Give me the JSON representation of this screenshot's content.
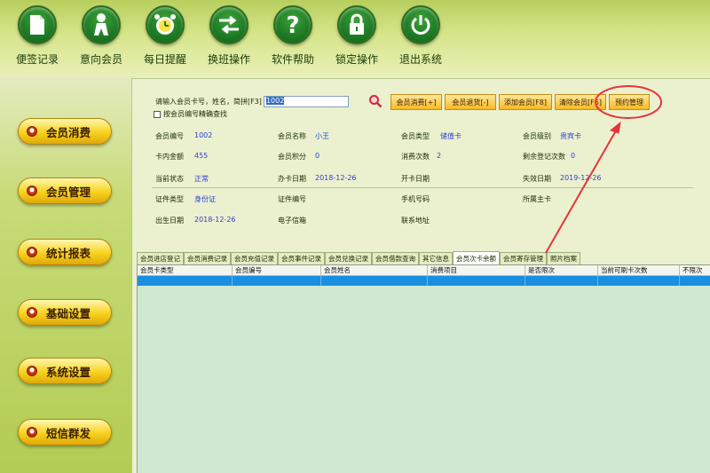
{
  "toolbar": {
    "items": [
      {
        "label": "便签记录",
        "icon": "note-icon"
      },
      {
        "label": "意向会员",
        "icon": "member-icon"
      },
      {
        "label": "每日提醒",
        "icon": "alarm-clock-icon"
      },
      {
        "label": "换班操作",
        "icon": "shift-swap-icon"
      },
      {
        "label": "软件帮助",
        "icon": "help-icon"
      },
      {
        "label": "锁定操作",
        "icon": "lock-icon"
      },
      {
        "label": "退出系统",
        "icon": "power-icon"
      }
    ]
  },
  "sidebar": {
    "items": [
      {
        "label": "会员消费"
      },
      {
        "label": "会员管理"
      },
      {
        "label": "统计报表"
      },
      {
        "label": "基础设置"
      },
      {
        "label": "系统设置"
      },
      {
        "label": "短信群发"
      }
    ]
  },
  "search": {
    "label": "请输入会员卡号，姓名，简拼[F3]",
    "value": "1002",
    "exact_label": "按会员编号精确查找"
  },
  "actions": [
    {
      "label": "会员消费[+]"
    },
    {
      "label": "会员退货[-]"
    },
    {
      "label": "添加会员[F8]"
    },
    {
      "label": "清除会员[F6]"
    },
    {
      "label": "预约管理"
    }
  ],
  "info": {
    "row1": [
      {
        "label": "会员编号",
        "value": "1002"
      },
      {
        "label": "会员名称",
        "value": "小王"
      },
      {
        "label": "会员类型",
        "value": "储值卡"
      },
      {
        "label": "会员级别",
        "value": "贵宾卡"
      }
    ],
    "row2": [
      {
        "label": "卡内金额",
        "value": "455"
      },
      {
        "label": "会员积分",
        "value": "0"
      },
      {
        "label": "消费次数",
        "value": "2"
      },
      {
        "label": "剩余登记次数",
        "value": "0"
      }
    ],
    "row3": [
      {
        "label": "当前状态",
        "value": "正常"
      },
      {
        "label": "办卡日期",
        "value": "2018-12-26"
      },
      {
        "label": "开卡日期",
        "value": ""
      },
      {
        "label": "失效日期",
        "value": "2019-12-26"
      }
    ],
    "row4": [
      {
        "label": "证件类型",
        "value": "身份证"
      },
      {
        "label": "证件编号",
        "value": ""
      },
      {
        "label": "手机号码",
        "value": ""
      },
      {
        "label": "所属主卡",
        "value": ""
      }
    ],
    "row5": [
      {
        "label": "出生日期",
        "value": "2018-12-26"
      },
      {
        "label": "电子信箱",
        "value": ""
      },
      {
        "label": "联系地址",
        "value": ""
      }
    ]
  },
  "tabs": [
    {
      "label": "会员进店登记"
    },
    {
      "label": "会员消费记录"
    },
    {
      "label": "会员充值记录"
    },
    {
      "label": "会员事件记录"
    },
    {
      "label": "会员兑换记录"
    },
    {
      "label": "会员借款查询"
    },
    {
      "label": "其它信息"
    },
    {
      "label": "会员次卡余额",
      "active": true
    },
    {
      "label": "会员寄存管理"
    },
    {
      "label": "照片档案"
    }
  ],
  "grid": {
    "columns": [
      "会员卡类型",
      "会员编号",
      "会员姓名",
      "消费项目",
      "是否限次",
      "当前可刷卡次数",
      "不限次"
    ]
  },
  "colors": {
    "toolbar_green": "#1d7a24",
    "sidebar_button": "#f7d21e",
    "action_button": "#f9b923",
    "value_text": "#2d3ed0",
    "annotation": "#e8323a",
    "grid_bg": "#cfe8d1",
    "grid_selected": "#1a8fe0"
  }
}
